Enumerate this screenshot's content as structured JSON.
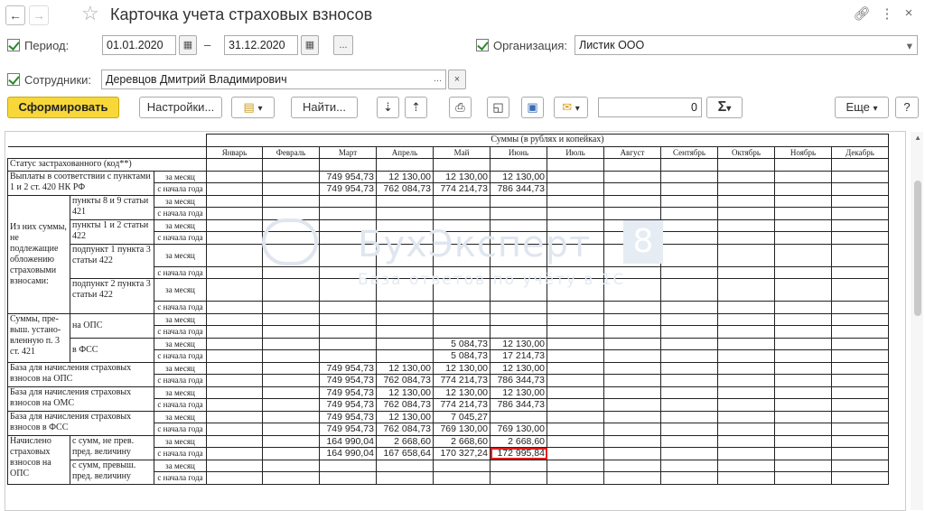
{
  "window": {
    "title": "Карточка учета страховых взносов"
  },
  "nav": {
    "back": "←",
    "forward": "→",
    "star": "☆"
  },
  "period": {
    "label": "Период:",
    "from": "01.01.2020",
    "dash": "–",
    "to": "31.12.2020",
    "dots": "..."
  },
  "org": {
    "label": "Организация:",
    "value": "Листик ООО"
  },
  "employee": {
    "label": "Сотрудники:",
    "value": "Деревцов Дмитрий Владимирович",
    "dots": "...",
    "clear": "×"
  },
  "toolbar": {
    "generate": "Сформировать",
    "settings": "Настройки...",
    "find": "Найти...",
    "amount": "0",
    "sigma": "Σ",
    "more": "Еще",
    "help": "?"
  },
  "watermark": {
    "brand": "БухЭксперт",
    "digit": "8",
    "tagline": "База ответов по учёту в 1С"
  },
  "report": {
    "sums_caption": "Суммы (в рублях и копейках)",
    "status_label": "Статус застрахованного (код**)",
    "months": [
      "Январь",
      "Февраль",
      "Март",
      "Апрель",
      "Май",
      "Июнь",
      "Июль",
      "Август",
      "Сентябрь",
      "Октябрь",
      "Ноябрь",
      "Декабрь"
    ],
    "per_month": "за месяц",
    "ytd": "с начала года",
    "sec1": "Выплаты в соответствии с пунктами 1 и 2 ст. 420 НК РФ",
    "sec1_month": [
      "",
      "",
      "749 954,73",
      "12 130,00",
      "12 130,00",
      "12 130,00"
    ],
    "sec1_ytd": [
      "",
      "",
      "749 954,73",
      "762 084,73",
      "774 214,73",
      "786 344,73"
    ],
    "sec2": "Из них суммы, не подлежащие обложению страховыми взносами:",
    "sub_89": "пункты 8 и 9 статьи 421",
    "sub_12": "пункты 1 и 2 статьи 422",
    "sub_p1": "подпункт 1 пункта 3 статьи 422",
    "sub_p2": "подпункт 2 пункта 3 статьи 422",
    "sec3": "Суммы, пре-выш. устано-вленную п. 3 ст. 421",
    "ops": "на ОПС",
    "fss": "в ФСС",
    "fss_month": [
      "",
      "",
      "",
      "",
      "5 084,73",
      "12 130,00"
    ],
    "fss_ytd": [
      "",
      "",
      "",
      "",
      "5 084,73",
      "17 214,73"
    ],
    "base_ops": "База для начисления страховых взносов на ОПС",
    "base_ops_month": [
      "",
      "",
      "749 954,73",
      "12 130,00",
      "12 130,00",
      "12 130,00"
    ],
    "base_ops_ytd": [
      "",
      "",
      "749 954,73",
      "762 084,73",
      "774 214,73",
      "786 344,73"
    ],
    "base_oms": "База для начисления страховых взносов на ОМС",
    "base_oms_month": [
      "",
      "",
      "749 954,73",
      "12 130,00",
      "12 130,00",
      "12 130,00"
    ],
    "base_oms_ytd": [
      "",
      "",
      "749 954,73",
      "762 084,73",
      "774 214,73",
      "786 344,73"
    ],
    "base_fss": "База для начисления страховых взносов в ФСС",
    "base_fss_month": [
      "",
      "",
      "749 954,73",
      "12 130,00",
      "7 045,27",
      ""
    ],
    "base_fss_ytd": [
      "",
      "",
      "749 954,73",
      "762 084,73",
      "769 130,00",
      "769 130,00"
    ],
    "accr": "Начислено страховых взносов на ОПС",
    "accr_sub1": "с сумм, не прев. пред. величину",
    "accr_sub1_month": [
      "",
      "",
      "164 990,04",
      "2 668,60",
      "2 668,60",
      "2 668,60"
    ],
    "accr_sub1_ytd": [
      "",
      "",
      "164 990,04",
      "167 658,64",
      "170 327,24",
      "172 995,84"
    ],
    "accr_sub2": "с сумм, превыш. пред. величину"
  }
}
